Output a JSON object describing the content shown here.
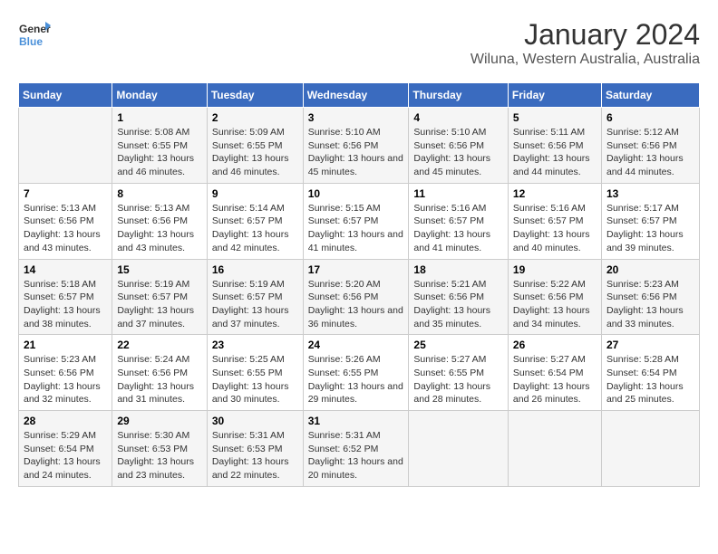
{
  "logo": {
    "text_general": "General",
    "text_blue": "Blue"
  },
  "title": "January 2024",
  "subtitle": "Wiluna, Western Australia, Australia",
  "headers": [
    "Sunday",
    "Monday",
    "Tuesday",
    "Wednesday",
    "Thursday",
    "Friday",
    "Saturday"
  ],
  "weeks": [
    [
      {
        "day": "",
        "sunrise": "",
        "sunset": "",
        "daylight": ""
      },
      {
        "day": "1",
        "sunrise": "Sunrise: 5:08 AM",
        "sunset": "Sunset: 6:55 PM",
        "daylight": "Daylight: 13 hours and 46 minutes."
      },
      {
        "day": "2",
        "sunrise": "Sunrise: 5:09 AM",
        "sunset": "Sunset: 6:55 PM",
        "daylight": "Daylight: 13 hours and 46 minutes."
      },
      {
        "day": "3",
        "sunrise": "Sunrise: 5:10 AM",
        "sunset": "Sunset: 6:56 PM",
        "daylight": "Daylight: 13 hours and 45 minutes."
      },
      {
        "day": "4",
        "sunrise": "Sunrise: 5:10 AM",
        "sunset": "Sunset: 6:56 PM",
        "daylight": "Daylight: 13 hours and 45 minutes."
      },
      {
        "day": "5",
        "sunrise": "Sunrise: 5:11 AM",
        "sunset": "Sunset: 6:56 PM",
        "daylight": "Daylight: 13 hours and 44 minutes."
      },
      {
        "day": "6",
        "sunrise": "Sunrise: 5:12 AM",
        "sunset": "Sunset: 6:56 PM",
        "daylight": "Daylight: 13 hours and 44 minutes."
      }
    ],
    [
      {
        "day": "7",
        "sunrise": "Sunrise: 5:13 AM",
        "sunset": "Sunset: 6:56 PM",
        "daylight": "Daylight: 13 hours and 43 minutes."
      },
      {
        "day": "8",
        "sunrise": "Sunrise: 5:13 AM",
        "sunset": "Sunset: 6:56 PM",
        "daylight": "Daylight: 13 hours and 43 minutes."
      },
      {
        "day": "9",
        "sunrise": "Sunrise: 5:14 AM",
        "sunset": "Sunset: 6:57 PM",
        "daylight": "Daylight: 13 hours and 42 minutes."
      },
      {
        "day": "10",
        "sunrise": "Sunrise: 5:15 AM",
        "sunset": "Sunset: 6:57 PM",
        "daylight": "Daylight: 13 hours and 41 minutes."
      },
      {
        "day": "11",
        "sunrise": "Sunrise: 5:16 AM",
        "sunset": "Sunset: 6:57 PM",
        "daylight": "Daylight: 13 hours and 41 minutes."
      },
      {
        "day": "12",
        "sunrise": "Sunrise: 5:16 AM",
        "sunset": "Sunset: 6:57 PM",
        "daylight": "Daylight: 13 hours and 40 minutes."
      },
      {
        "day": "13",
        "sunrise": "Sunrise: 5:17 AM",
        "sunset": "Sunset: 6:57 PM",
        "daylight": "Daylight: 13 hours and 39 minutes."
      }
    ],
    [
      {
        "day": "14",
        "sunrise": "Sunrise: 5:18 AM",
        "sunset": "Sunset: 6:57 PM",
        "daylight": "Daylight: 13 hours and 38 minutes."
      },
      {
        "day": "15",
        "sunrise": "Sunrise: 5:19 AM",
        "sunset": "Sunset: 6:57 PM",
        "daylight": "Daylight: 13 hours and 37 minutes."
      },
      {
        "day": "16",
        "sunrise": "Sunrise: 5:19 AM",
        "sunset": "Sunset: 6:57 PM",
        "daylight": "Daylight: 13 hours and 37 minutes."
      },
      {
        "day": "17",
        "sunrise": "Sunrise: 5:20 AM",
        "sunset": "Sunset: 6:56 PM",
        "daylight": "Daylight: 13 hours and 36 minutes."
      },
      {
        "day": "18",
        "sunrise": "Sunrise: 5:21 AM",
        "sunset": "Sunset: 6:56 PM",
        "daylight": "Daylight: 13 hours and 35 minutes."
      },
      {
        "day": "19",
        "sunrise": "Sunrise: 5:22 AM",
        "sunset": "Sunset: 6:56 PM",
        "daylight": "Daylight: 13 hours and 34 minutes."
      },
      {
        "day": "20",
        "sunrise": "Sunrise: 5:23 AM",
        "sunset": "Sunset: 6:56 PM",
        "daylight": "Daylight: 13 hours and 33 minutes."
      }
    ],
    [
      {
        "day": "21",
        "sunrise": "Sunrise: 5:23 AM",
        "sunset": "Sunset: 6:56 PM",
        "daylight": "Daylight: 13 hours and 32 minutes."
      },
      {
        "day": "22",
        "sunrise": "Sunrise: 5:24 AM",
        "sunset": "Sunset: 6:56 PM",
        "daylight": "Daylight: 13 hours and 31 minutes."
      },
      {
        "day": "23",
        "sunrise": "Sunrise: 5:25 AM",
        "sunset": "Sunset: 6:55 PM",
        "daylight": "Daylight: 13 hours and 30 minutes."
      },
      {
        "day": "24",
        "sunrise": "Sunrise: 5:26 AM",
        "sunset": "Sunset: 6:55 PM",
        "daylight": "Daylight: 13 hours and 29 minutes."
      },
      {
        "day": "25",
        "sunrise": "Sunrise: 5:27 AM",
        "sunset": "Sunset: 6:55 PM",
        "daylight": "Daylight: 13 hours and 28 minutes."
      },
      {
        "day": "26",
        "sunrise": "Sunrise: 5:27 AM",
        "sunset": "Sunset: 6:54 PM",
        "daylight": "Daylight: 13 hours and 26 minutes."
      },
      {
        "day": "27",
        "sunrise": "Sunrise: 5:28 AM",
        "sunset": "Sunset: 6:54 PM",
        "daylight": "Daylight: 13 hours and 25 minutes."
      }
    ],
    [
      {
        "day": "28",
        "sunrise": "Sunrise: 5:29 AM",
        "sunset": "Sunset: 6:54 PM",
        "daylight": "Daylight: 13 hours and 24 minutes."
      },
      {
        "day": "29",
        "sunrise": "Sunrise: 5:30 AM",
        "sunset": "Sunset: 6:53 PM",
        "daylight": "Daylight: 13 hours and 23 minutes."
      },
      {
        "day": "30",
        "sunrise": "Sunrise: 5:31 AM",
        "sunset": "Sunset: 6:53 PM",
        "daylight": "Daylight: 13 hours and 22 minutes."
      },
      {
        "day": "31",
        "sunrise": "Sunrise: 5:31 AM",
        "sunset": "Sunset: 6:52 PM",
        "daylight": "Daylight: 13 hours and 20 minutes."
      },
      {
        "day": "",
        "sunrise": "",
        "sunset": "",
        "daylight": ""
      },
      {
        "day": "",
        "sunrise": "",
        "sunset": "",
        "daylight": ""
      },
      {
        "day": "",
        "sunrise": "",
        "sunset": "",
        "daylight": ""
      }
    ]
  ]
}
